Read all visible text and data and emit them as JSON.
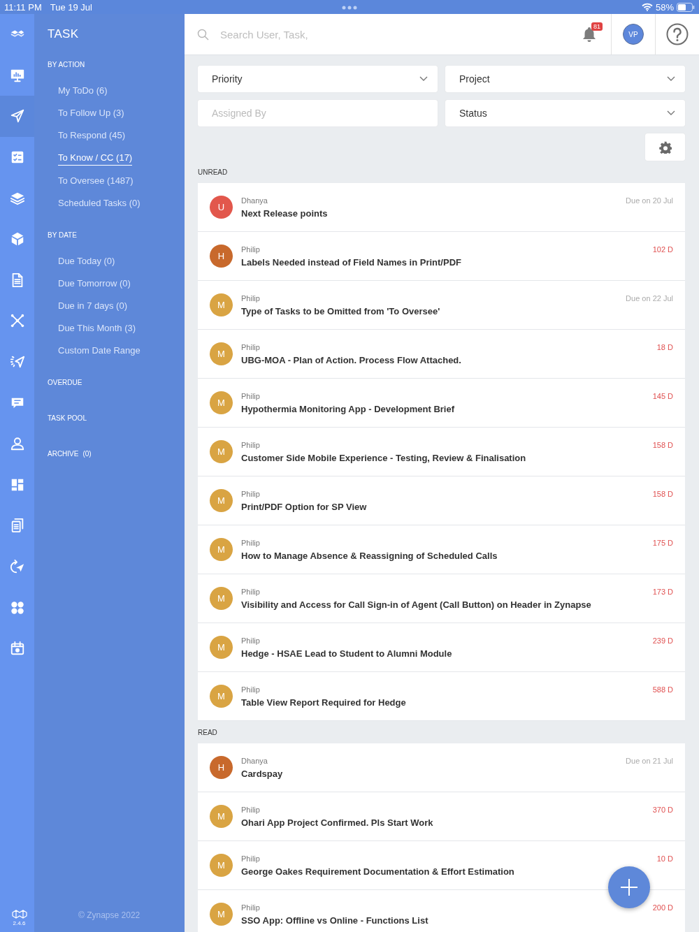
{
  "status_bar": {
    "time": "11:11 PM",
    "date": "Tue 19 Jul",
    "battery": "58%"
  },
  "rail": {
    "items": [
      {
        "selected": false
      },
      {
        "selected": false
      },
      {
        "selected": true
      },
      {
        "selected": false
      },
      {
        "selected": false
      },
      {
        "selected": false
      },
      {
        "selected": false
      },
      {
        "selected": false
      },
      {
        "selected": false
      },
      {
        "selected": false
      },
      {
        "selected": false
      },
      {
        "selected": false
      },
      {
        "selected": false
      },
      {
        "selected": false
      },
      {
        "selected": false
      },
      {
        "selected": false
      }
    ],
    "version": "2.4.6"
  },
  "sidebar": {
    "title": "TASK",
    "sections": [
      {
        "heading": "BY ACTION",
        "items": [
          {
            "label": "My ToDo (6)",
            "selected": false
          },
          {
            "label": "To Follow Up (3)",
            "selected": false
          },
          {
            "label": "To Respond (45)",
            "selected": false
          },
          {
            "label": "To Know / CC (17)",
            "selected": true
          },
          {
            "label": "To Oversee (1487)",
            "selected": false
          },
          {
            "label": "Scheduled Tasks (0)",
            "selected": false
          }
        ]
      },
      {
        "heading": "BY DATE",
        "items": [
          {
            "label": "Due Today (0)",
            "selected": false
          },
          {
            "label": "Due Tomorrow (0)",
            "selected": false
          },
          {
            "label": "Due in 7 days (0)",
            "selected": false
          },
          {
            "label": "Due This Month (3)",
            "selected": false
          },
          {
            "label": "Custom Date Range",
            "selected": false
          }
        ]
      },
      {
        "heading": "OVERDUE"
      },
      {
        "heading": "TASK POOL"
      },
      {
        "heading": "ARCHIVE",
        "count": "(0)"
      }
    ],
    "footer": "© Zynapse 2022"
  },
  "header": {
    "search": {
      "placeholder": "Search User, Task,"
    },
    "notifications": "81",
    "avatar": "VP"
  },
  "filters": [
    {
      "kind": "dropdown",
      "label": "Priority"
    },
    {
      "kind": "dropdown",
      "label": "Project"
    },
    {
      "kind": "input",
      "placeholder": "Assigned By"
    },
    {
      "kind": "dropdown",
      "label": "Status"
    }
  ],
  "sections": [
    {
      "title": "UNREAD",
      "tasks": [
        {
          "initial": "U",
          "color": "#e2574c",
          "sender": "Dhanya",
          "title": "Next Release points",
          "due": "Due on 20 Jul",
          "overdue": false
        },
        {
          "initial": "H",
          "color": "#c8692c",
          "sender": "Philip",
          "title": "Labels Needed instead of Field Names in Print/PDF",
          "due": "102 D",
          "overdue": true
        },
        {
          "initial": "M",
          "color": "#d9a443",
          "sender": "Philip",
          "title": "Type of Tasks to be Omitted from 'To Oversee'",
          "due": "Due on 22 Jul",
          "overdue": false
        },
        {
          "initial": "M",
          "color": "#d9a443",
          "sender": "Philip",
          "title": "UBG-MOA - Plan of Action. Process Flow Attached.",
          "due": "18 D",
          "overdue": true
        },
        {
          "initial": "M",
          "color": "#d9a443",
          "sender": "Philip",
          "title": "Hypothermia Monitoring App - Development Brief",
          "due": "145 D",
          "overdue": true
        },
        {
          "initial": "M",
          "color": "#d9a443",
          "sender": "Philip",
          "title": "Customer Side Mobile Experience - Testing, Review & Finalisation",
          "due": "158 D",
          "overdue": true
        },
        {
          "initial": "M",
          "color": "#d9a443",
          "sender": "Philip",
          "title": "Print/PDF Option for SP View",
          "due": "158 D",
          "overdue": true
        },
        {
          "initial": "M",
          "color": "#d9a443",
          "sender": "Philip",
          "title": "How to Manage Absence & Reassigning of Scheduled Calls",
          "due": "175 D",
          "overdue": true
        },
        {
          "initial": "M",
          "color": "#d9a443",
          "sender": "Philip",
          "title": "Visibility and Access for Call Sign-in of Agent (Call Button) on Header in Zynapse",
          "due": "173 D",
          "overdue": true
        },
        {
          "initial": "M",
          "color": "#d9a443",
          "sender": "Philip",
          "title": "Hedge - HSAE Lead to Student to Alumni Module",
          "due": "239 D",
          "overdue": true
        },
        {
          "initial": "M",
          "color": "#d9a443",
          "sender": "Philip",
          "title": "Table View Report Required for Hedge",
          "due": "588 D",
          "overdue": true
        }
      ]
    },
    {
      "title": "READ",
      "tasks": [
        {
          "initial": "H",
          "color": "#c8692c",
          "sender": "Dhanya",
          "title": "Cardspay",
          "due": "Due on 21 Jul",
          "overdue": false
        },
        {
          "initial": "M",
          "color": "#d9a443",
          "sender": "Philip",
          "title": "Ohari App Project Confirmed. Pls Start Work",
          "due": "370 D",
          "overdue": true
        },
        {
          "initial": "M",
          "color": "#d9a443",
          "sender": "Philip",
          "title": "George Oakes Requirement Documentation & Effort Estimation",
          "due": "10 D",
          "overdue": true
        },
        {
          "initial": "M",
          "color": "#d9a443",
          "sender": "Philip",
          "title": "SSO App: Offline vs Online - Functions List",
          "due": "200 D",
          "overdue": true
        }
      ]
    }
  ]
}
